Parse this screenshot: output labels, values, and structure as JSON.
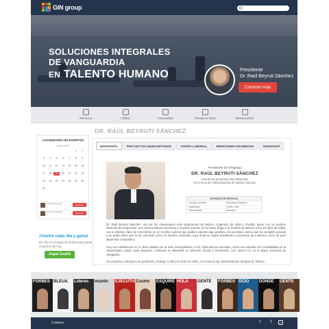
{
  "brand": {
    "name": "GIN group"
  },
  "hero": {
    "line1": "SOLUCIONES INTEGRALES",
    "line2": "DE VANGUARDIA",
    "line3_prefix": "EN",
    "line3_main": "TALENTO HUMANO",
    "president_role": "Presidente",
    "president_name": "Dr. Raúl Beyruti Sánchez",
    "cta": "Conocer más"
  },
  "nav": {
    "items": [
      {
        "label": "Servicios",
        "icon": "users-icon"
      },
      {
        "label": "Filiales",
        "icon": "building-icon"
      },
      {
        "label": "Comunidad",
        "icon": "community-icon"
      },
      {
        "label": "Tienda en línea",
        "icon": "cart-icon"
      },
      {
        "label": "Restaurantes",
        "icon": "utensils-icon"
      }
    ]
  },
  "page_title": "DR. RAÚL BEYRUTI SÁNCHEZ",
  "calendar": {
    "title": "CALENDARIO DE EVENTOS",
    "month": "JULIO 2017",
    "days": [
      "",
      "",
      "",
      "",
      "",
      "1",
      "2",
      "3",
      "4",
      "5",
      "6",
      "7",
      "8",
      "9",
      "10",
      "11",
      "12",
      "13",
      "14",
      "15",
      "16",
      "17",
      "18",
      "19",
      "20",
      "21",
      "22",
      "23",
      "24",
      "25",
      "26",
      "27",
      "28",
      "29",
      "30",
      "31",
      "",
      "",
      "",
      "",
      ""
    ],
    "events": [
      {
        "text": "Evento GINgroup",
        "button": "Registrar"
      },
      {
        "text": "Evento GINgroup",
        "button": "Registrar"
      }
    ]
  },
  "promo": {
    "title": "¡Vuelve cada día y gana!",
    "text": "Da clic en el siguiente botón para ganar el premio de hoy.",
    "button": "Jugar Gratis"
  },
  "tabs": [
    "BIOGRAFÍA",
    "PROYECTOS HUMANITARIOS",
    "VISIÓN LABORAL",
    "MENCIONES EN MEDIOS",
    "GINGROUP"
  ],
  "bio": {
    "role": "Presidente de GINgroup",
    "name": "DR. RAÚL BEYRUTI SÁNCHEZ",
    "subtitle1": "Una de las personas más influyentes",
    "subtitle2": "en el tema de Administración de Talento Humano",
    "info_header": "INFORMACIÓN PERSONAL",
    "info_rows": [
      {
        "k": "Nombre completo",
        "v": "Raúl Beyruti Sánchez"
      },
      {
        "k": "Nacimiento",
        "v": "Puebla, 1962"
      },
      {
        "k": "Nacionalidad",
        "v": "Mexicano"
      }
    ],
    "p1": "Dr. Raúl Beyruti Sánchez, uno de los empresarios más importantes de México, originario de Atlixco, Puebla, quien con un espíritu deseoso de emprender una carrera laboral victoriosa y muchos sueños en la bolsa, llega a la Ciudad de México a los 16 años de edad, con el objetivo claro de convertirse en un hombre exitoso que pudiera aportar algo positivo a la sociedad, deseo que ha cumplido gracias a su arduo labor que lo ha colocado como un hombre visionario cuya meta se seguir invirtiendo y proyectan de a México como un país altamente competitivo.",
    "p2": "Una vez establecido en el ritmo citadino de la urbe metropolitana, el Dr. Raúl Beyruti Sánchez, inició sus estudios de Contabilidad en la Universidad Latina, para después, continuar su Maestría en Derecho Fiscal y Administra- ción (M.D.F.A.) en la Barra Nacional de Abogados.",
    "p3": "Su empeño y entrega a su profesión y trabajo, lo llevó a crear en 1991, el consorcio de Administración Integral de Talento"
  },
  "magazines": [
    {
      "title": "FORBES",
      "bg": "#1c1c1c",
      "fig": "#b88a6e"
    },
    {
      "title": "BLEU&",
      "bg": "#f4f4f4",
      "fig": "#3b3b3b"
    },
    {
      "title": "Líderes",
      "bg": "#2b2b2b",
      "fig": "#caa086"
    },
    {
      "title": "mundo",
      "bg": "#d6d6d6",
      "fig": "#e8d0c0"
    },
    {
      "title": "EJECUTIVOS",
      "bg": "#b5241c",
      "fig": "#b78a6c"
    },
    {
      "title": "Cosmo",
      "bg": "#e7d2c2",
      "fig": "#7b4a3c"
    },
    {
      "title": "ESQUIRE",
      "bg": "#101010",
      "fig": "#a07a60"
    },
    {
      "title": "HOLA",
      "bg": "#c8303a",
      "fig": "#d6b89c"
    },
    {
      "title": "GENTE",
      "bg": "#f1f1f1",
      "fig": "#2f2f2f"
    },
    {
      "title": "FORBES",
      "bg": "#3d2b22",
      "fig": "#c99a7c"
    },
    {
      "title": "OCIO",
      "bg": "#1f5b8c",
      "fig": "#d9a888"
    },
    {
      "title": "DÓNDE",
      "bg": "#0d0d0d",
      "fig": "#b88e6e"
    },
    {
      "title": "GENTE",
      "bg": "#5a3a28",
      "fig": "#d2b08e"
    }
  ],
  "footer": {
    "contact": "Contacto",
    "social": [
      "twitter-icon",
      "facebook-icon",
      "instagram-icon"
    ]
  },
  "colors": {
    "navy": "#24344d",
    "accent_red": "#e0473c",
    "promo_blue": "#1a9fd6",
    "play_green": "#5ab43c"
  }
}
